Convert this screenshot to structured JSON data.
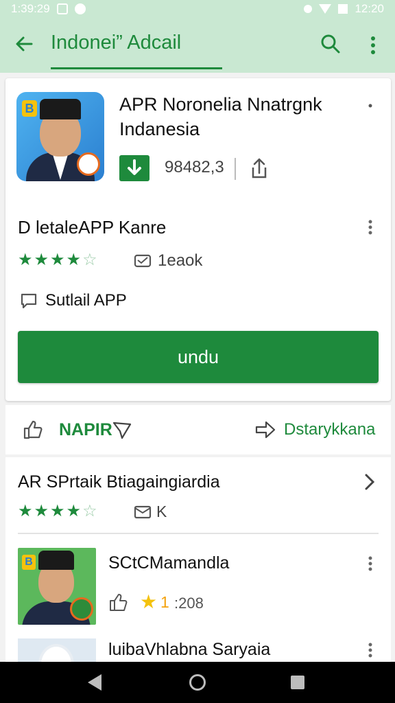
{
  "status_bar": {
    "time_left": "1:39:29",
    "time_right": "12:20"
  },
  "app_bar": {
    "title": "Indonei” Adcail",
    "icons": [
      "arrow-left-icon",
      "search-icon",
      "more-vert-icon"
    ]
  },
  "app": {
    "title": "APR Noronelia Nnatrgnk Indanesia",
    "download_count": "98482,3",
    "section_title": "D letaleAPP Kanre",
    "rating_stars": 4.5,
    "review_count": "1eaok",
    "detail_label": "Sutlail APP",
    "install_label": "undu"
  },
  "action_bar": {
    "like_label": "NAPIR",
    "share_label": "Dstarykkana"
  },
  "related": {
    "title": "AR SPrtaik Btiagaingiardia",
    "rating_stars": 4.5,
    "review_count": "K",
    "items": [
      {
        "title": "SCtCMamandla",
        "rating": "1",
        "count": ":208"
      },
      {
        "title": "luibaVhlabna Saryaia"
      }
    ]
  },
  "colors": {
    "accent": "#1e8a3c",
    "appbar_bg": "#c9e8d2",
    "star_yellow": "#f4c20d"
  }
}
